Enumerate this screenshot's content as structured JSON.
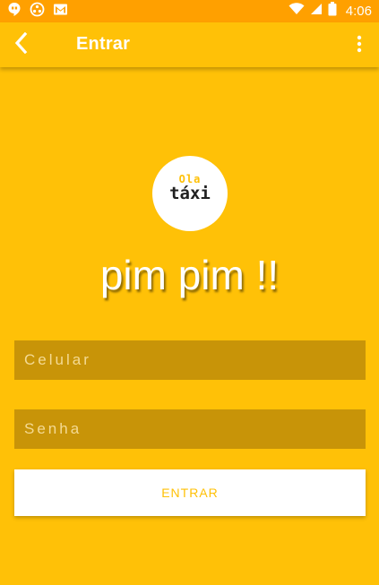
{
  "status_bar": {
    "time": "4:06",
    "left_icons": [
      "hangouts-icon",
      "sync-icon",
      "gmail-icon"
    ],
    "right_icons": [
      "wifi-icon",
      "cellular-signal-icon",
      "battery-icon"
    ]
  },
  "app_bar": {
    "title": "Entrar",
    "back_icon": "chevron-left-icon",
    "menu_icon": "overflow-menu-icon"
  },
  "logo": {
    "line1": "Ola",
    "line2": "táxi"
  },
  "headline": "pim pim !!",
  "form": {
    "phone_placeholder": "Celular",
    "password_placeholder": "Senha",
    "submit_label": "ENTRAR"
  },
  "colors": {
    "background": "#FFC107",
    "status_bar": "#FFA000",
    "input_fill": "#C89408",
    "button_text": "#FFC107"
  }
}
